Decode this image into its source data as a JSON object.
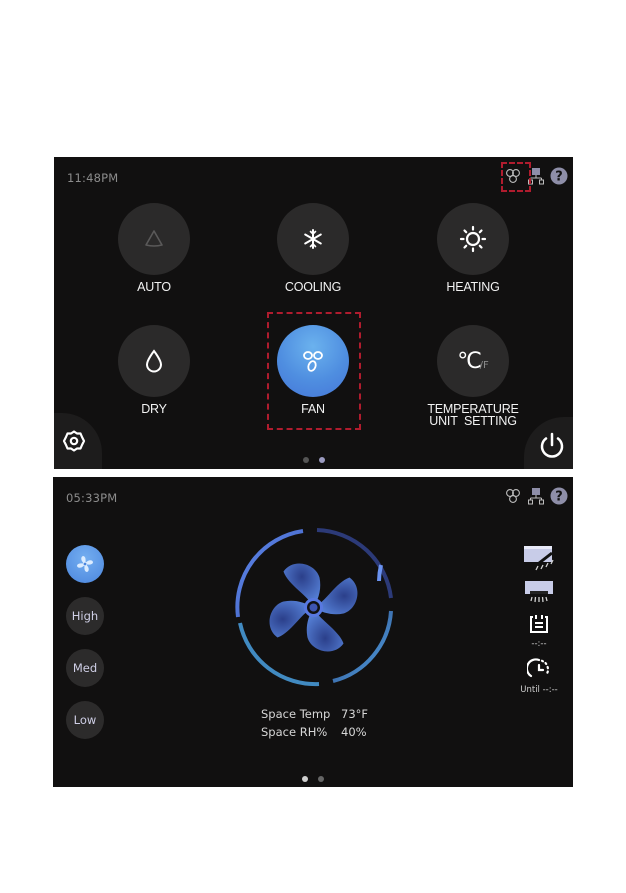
{
  "screen1": {
    "time": "11:48PM",
    "status_icons": [
      "fan-status-icon",
      "network-icon",
      "help-icon"
    ],
    "modes": [
      {
        "id": "auto",
        "label": "AUTO",
        "icon": "auto-triangle-icon",
        "active": false
      },
      {
        "id": "cooling",
        "label": "COOLING",
        "icon": "snowflake-icon",
        "active": false
      },
      {
        "id": "heating",
        "label": "HEATING",
        "icon": "sun-icon",
        "active": false
      },
      {
        "id": "dry",
        "label": "DRY",
        "icon": "water-drop-icon",
        "active": false
      },
      {
        "id": "fan",
        "label": "FAN",
        "icon": "fan-icon",
        "active": true
      },
      {
        "id": "temp-unit",
        "label_line1": "TEMPERATURE",
        "label_line2": "UNIT  SETTING",
        "icon": "celsius-fahrenheit-icon",
        "active": false
      }
    ],
    "unit_glyph": "°C",
    "unit_suffix": "/F",
    "settings_icon": "gear-icon",
    "power_icon": "power-icon",
    "page_dots": {
      "count": 2,
      "active_index": 1
    }
  },
  "screen2": {
    "time": "05:33PM",
    "status_icons": [
      "fan-status-icon",
      "network-icon",
      "help-icon"
    ],
    "fan_speeds": [
      {
        "label": "",
        "icon": "fan-auto-icon",
        "active": true
      },
      {
        "label": "High",
        "active": false
      },
      {
        "label": "Med",
        "active": false
      },
      {
        "label": "Low",
        "active": false
      }
    ],
    "right_controls": [
      {
        "icon": "louver-swing-icon",
        "sub": ""
      },
      {
        "icon": "louver-fixed-icon",
        "sub": ""
      },
      {
        "icon": "schedule-icon",
        "sub": "--:--"
      },
      {
        "icon": "timer-icon",
        "sub": "Until --:--"
      }
    ],
    "space_temp_label": "Space Temp",
    "space_temp_value": "73°F",
    "space_rh_label": "Space RH%",
    "space_rh_value": "40%",
    "page_dots": {
      "count": 2,
      "active_index": 0
    }
  },
  "colors": {
    "panel_bg": "#111010",
    "button_bg": "#2b2a2a",
    "accent_blue": "#4f8ee0",
    "highlight_red": "#b01c2e"
  }
}
